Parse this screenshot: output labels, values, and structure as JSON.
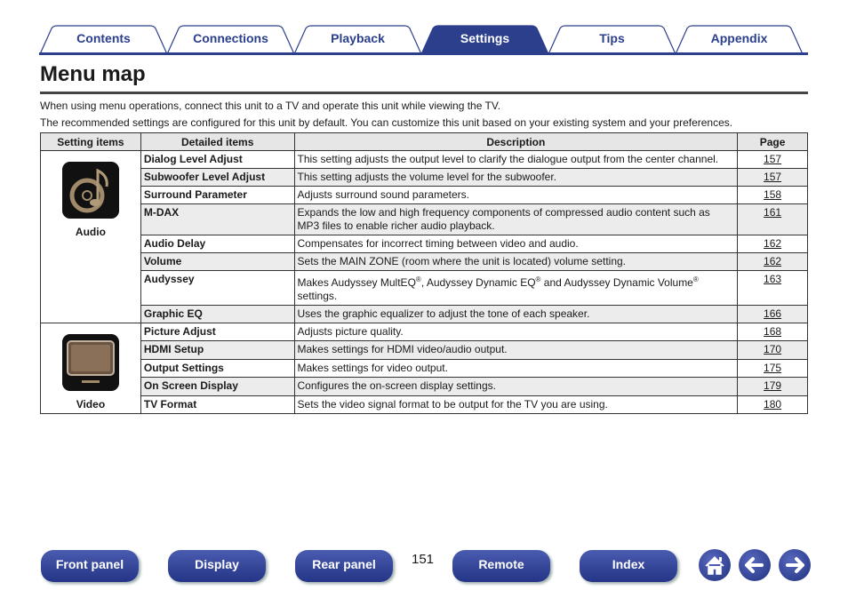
{
  "tabs": [
    {
      "label": "Contents",
      "active": false
    },
    {
      "label": "Connections",
      "active": false
    },
    {
      "label": "Playback",
      "active": false
    },
    {
      "label": "Settings",
      "active": true
    },
    {
      "label": "Tips",
      "active": false
    },
    {
      "label": "Appendix",
      "active": false
    }
  ],
  "page_title": "Menu map",
  "intro": [
    "When using menu operations, connect this unit to a TV and operate this unit while viewing the TV.",
    "The recommended settings are configured for this unit by default. You can customize this unit based on your existing system and your preferences."
  ],
  "table": {
    "headers": [
      "Setting items",
      "Detailed items",
      "Description",
      "Page"
    ],
    "groups": [
      {
        "category": "Audio",
        "icon": "music-note-disc-icon",
        "rows": [
          {
            "item": "Dialog Level Adjust",
            "desc": "This setting adjusts the output level to clarify the dialogue output from the center channel.",
            "page": "157"
          },
          {
            "item": "Subwoofer Level Adjust",
            "desc": "This setting adjusts the volume level for the subwoofer.",
            "page": "157"
          },
          {
            "item": "Surround Parameter",
            "desc": "Adjusts surround sound parameters.",
            "page": "158"
          },
          {
            "item": "M-DAX",
            "desc": "Expands the low and high frequency components of compressed audio content such as MP3 files to enable richer audio playback.",
            "page": "161"
          },
          {
            "item": "Audio Delay",
            "desc": "Compensates for incorrect timing between video and audio.",
            "page": "162"
          },
          {
            "item": "Volume",
            "desc": "Sets the MAIN ZONE (room where the unit is located) volume setting.",
            "page": "162"
          },
          {
            "item": "Audyssey",
            "desc_parts": [
              "Makes Audyssey MultEQ",
              "®",
              ", Audyssey Dynamic EQ",
              "®",
              " and Audyssey Dynamic Volume",
              "®",
              " settings."
            ],
            "page": "163"
          },
          {
            "item": "Graphic EQ",
            "desc": "Uses the graphic equalizer to adjust the tone of each speaker.",
            "page": "166"
          }
        ]
      },
      {
        "category": "Video",
        "icon": "tv-monitor-icon",
        "rows": [
          {
            "item": "Picture Adjust",
            "desc": "Adjusts picture quality.",
            "page": "168"
          },
          {
            "item": "HDMI Setup",
            "desc": "Makes settings for HDMI video/audio output.",
            "page": "170"
          },
          {
            "item": "Output Settings",
            "desc": "Makes settings for video output.",
            "page": "175"
          },
          {
            "item": "On Screen Display",
            "desc": "Configures the on-screen display settings.",
            "page": "179"
          },
          {
            "item": "TV Format",
            "desc": "Sets the video signal format to be output for the TV you are using.",
            "page": "180"
          }
        ]
      }
    ]
  },
  "footer": {
    "buttons": [
      "Front panel",
      "Display",
      "Rear panel",
      "Remote",
      "Index"
    ],
    "page_number": "151",
    "icons": [
      "home-icon",
      "arrow-left-icon",
      "arrow-right-icon"
    ]
  },
  "colors": {
    "brand": "#2b3f8c",
    "row_shade": "#ececec"
  }
}
